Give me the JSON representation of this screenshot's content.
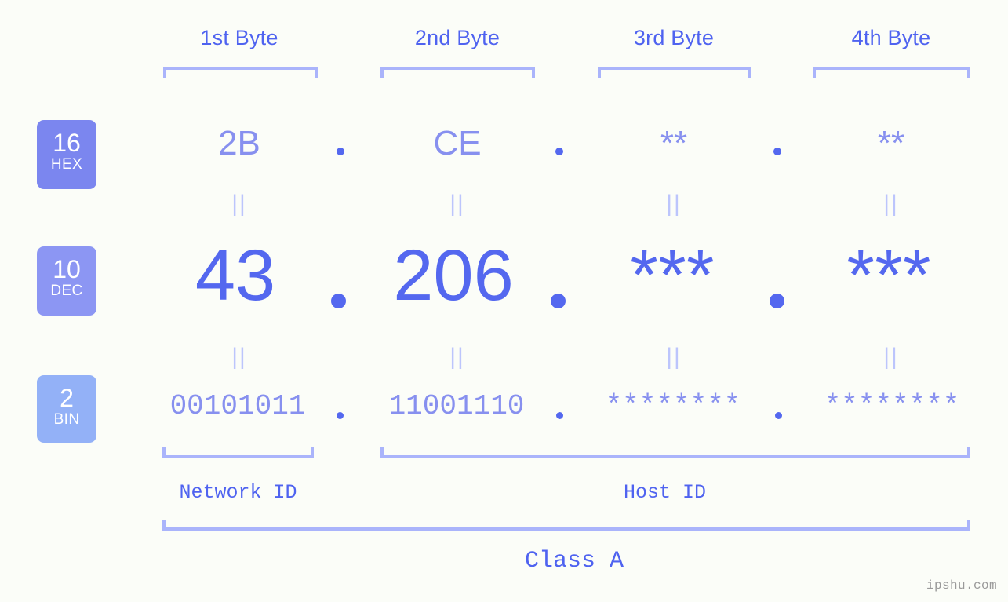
{
  "watermark": "ipshu.com",
  "byte_headers": [
    {
      "label": "1st Byte"
    },
    {
      "label": "2nd Byte"
    },
    {
      "label": "3rd Byte"
    },
    {
      "label": "4th Byte"
    }
  ],
  "bases": [
    {
      "num": "16",
      "name": "HEX",
      "color": "#7b86ef"
    },
    {
      "num": "10",
      "name": "DEC",
      "color": "#8c96f3"
    },
    {
      "num": "2",
      "name": "BIN",
      "color": "#93b1f7"
    }
  ],
  "rows": {
    "hex": {
      "values": [
        "2B",
        "CE",
        "**",
        "**"
      ],
      "separator": "."
    },
    "dec": {
      "values": [
        "43",
        "206",
        "***",
        "***"
      ],
      "separator": "."
    },
    "bin": {
      "values": [
        "00101011",
        "11001110",
        "********",
        "********"
      ],
      "separator": "."
    }
  },
  "connectors": {
    "symbol": "||",
    "count_per_row": 4
  },
  "segments": {
    "network_id": "Network ID",
    "host_id": "Host ID",
    "class": "Class A"
  },
  "colors": {
    "background": "#fbfdf8",
    "accent_strong": "#4f63f0",
    "accent_mid": "#5468ef",
    "accent_light": "#8790ef",
    "bracket": "#aab4fb",
    "connector": "#bcc5fc",
    "watermark": "#9a9a9a"
  }
}
